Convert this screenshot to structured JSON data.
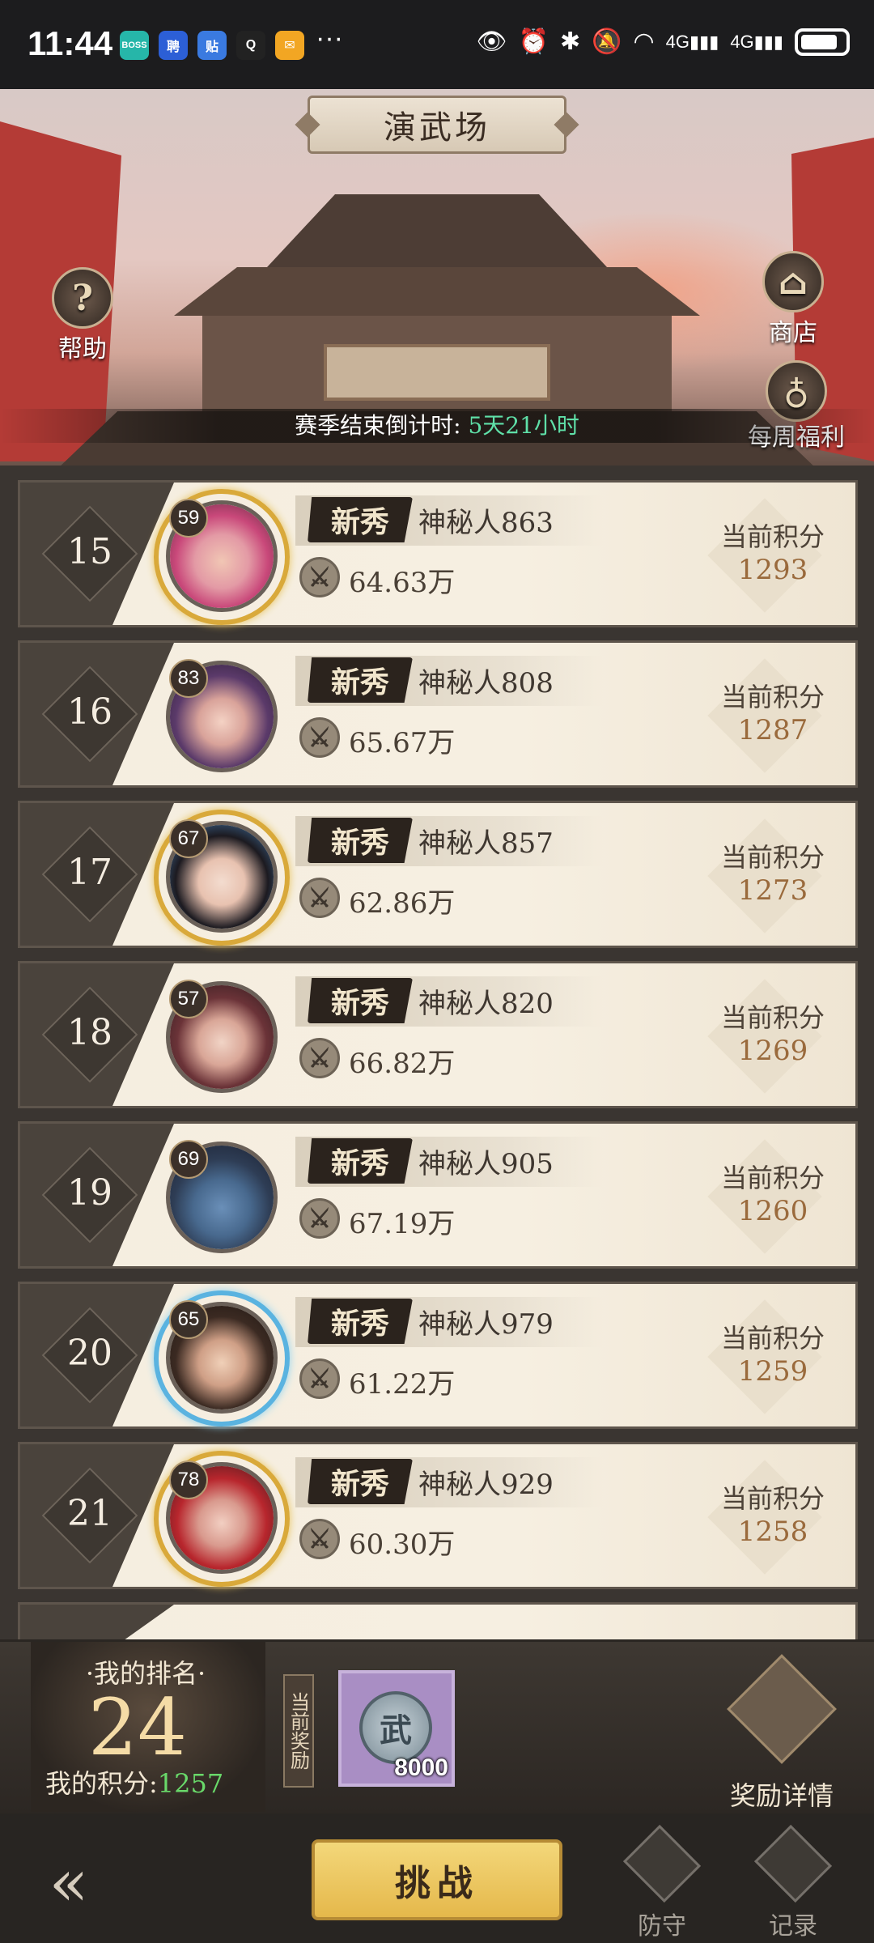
{
  "status_bar": {
    "time": "11:44",
    "apps": [
      {
        "name": "boss-app-icon",
        "text": "BOSS",
        "color": "#26b6a9"
      },
      {
        "name": "job-app-icon",
        "text": "聘",
        "color": "#2c5fd6"
      },
      {
        "name": "tieba-app-icon",
        "text": "贴",
        "color": "#3a7ae0"
      },
      {
        "name": "qq-app-icon",
        "text": "Q",
        "color": "#222222"
      },
      {
        "name": "mail-app-icon",
        "text": "✉",
        "color": "#f2a623"
      }
    ],
    "more": "···",
    "signal_text": "4G"
  },
  "header": {
    "title": "演武场",
    "help_label": "帮助",
    "help_glyph": "?",
    "shop_label": "商店",
    "weekly_label": "每周福利",
    "season_prefix": "赛季结束倒计时:",
    "season_countdown": "5天21小时"
  },
  "list": {
    "tag_label": "新秀",
    "score_label": "当前积分",
    "rows": [
      {
        "rank": "15",
        "level": "59",
        "name": "神秘人863",
        "power": "64.63万",
        "score": "1293"
      },
      {
        "rank": "16",
        "level": "83",
        "name": "神秘人808",
        "power": "65.67万",
        "score": "1287"
      },
      {
        "rank": "17",
        "level": "67",
        "name": "神秘人857",
        "power": "62.86万",
        "score": "1273"
      },
      {
        "rank": "18",
        "level": "57",
        "name": "神秘人820",
        "power": "66.82万",
        "score": "1269"
      },
      {
        "rank": "19",
        "level": "69",
        "name": "神秘人905",
        "power": "67.19万",
        "score": "1260"
      },
      {
        "rank": "20",
        "level": "65",
        "name": "神秘人979",
        "power": "61.22万",
        "score": "1259"
      },
      {
        "rank": "21",
        "level": "78",
        "name": "神秘人929",
        "power": "60.30万",
        "score": "1258"
      }
    ]
  },
  "my_panel": {
    "rank_label": "·我的排名·",
    "rank_value": "24",
    "score_label": "我的积分:",
    "score_value": "1257",
    "reward_tag": "当前奖励",
    "reward_glyph": "武",
    "reward_count": "8000",
    "reward_detail_label": "奖励详情"
  },
  "bottom_nav": {
    "challenge_label": "挑战",
    "defend_label": "防守",
    "record_label": "记录"
  },
  "colors": {
    "countdown": "#5fe0a8",
    "score_value": "#9a6a3c",
    "my_score": "#69d96a",
    "challenge_button": "#f3d77a"
  }
}
